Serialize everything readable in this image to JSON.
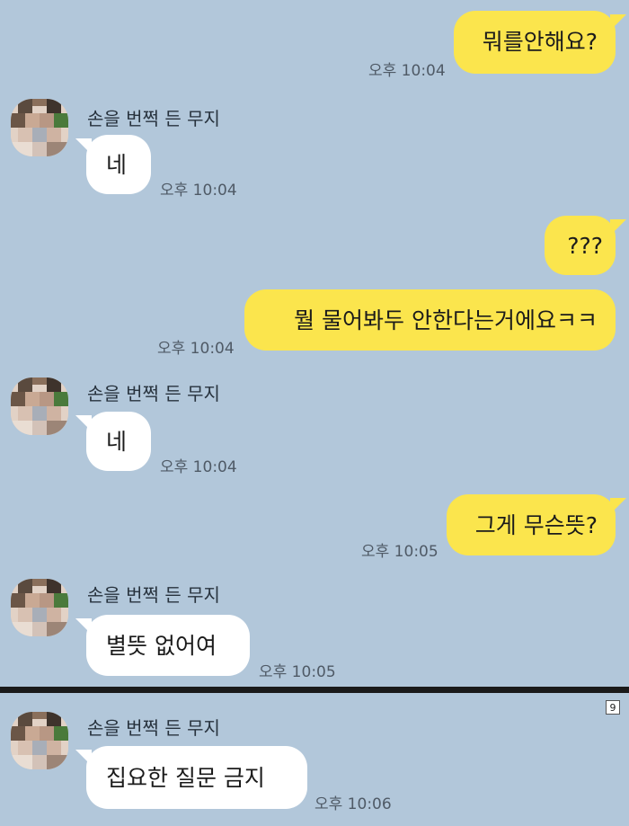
{
  "chat": {
    "contact_name": "손을 번쩍 든 무지",
    "messages": [
      {
        "sender": "me",
        "text": "뭐를안해요?",
        "time": "오후 10:04"
      },
      {
        "sender": "them",
        "text": "네",
        "time": "오후 10:04"
      },
      {
        "sender": "me",
        "text": "???",
        "time": ""
      },
      {
        "sender": "me",
        "text": "뭘 물어봐두 안한다는거에요ㅋㅋ",
        "time": "오후 10:04"
      },
      {
        "sender": "them",
        "text": "네",
        "time": "오후 10:04"
      },
      {
        "sender": "me",
        "text": "그게 무슨뜻?",
        "time": "오후 10:05"
      },
      {
        "sender": "them",
        "text": "별뜻 없어여",
        "time": "오후 10:05"
      },
      {
        "sender": "them",
        "text": "집요한 질문 금지",
        "time": "오후 10:06"
      }
    ]
  },
  "page_badge": "9",
  "colors": {
    "background": "#b2c7da",
    "my_bubble": "#fbe54d",
    "their_bubble": "#ffffff",
    "divider": "#1a1a1a"
  }
}
